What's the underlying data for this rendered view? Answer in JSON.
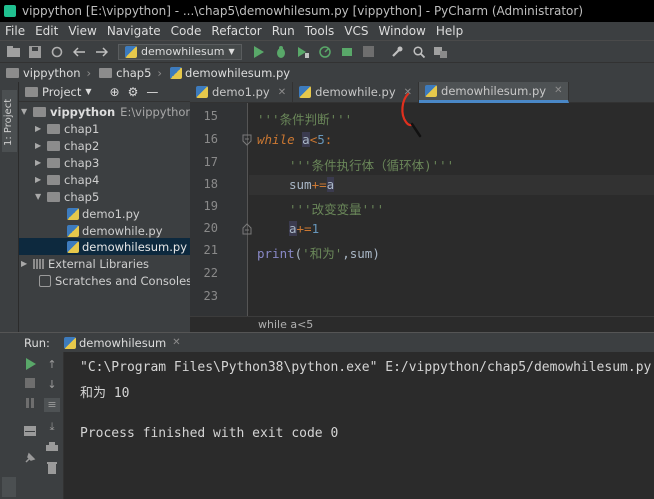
{
  "window": {
    "title": "vippython [E:\\vippython] - ...\\chap5\\demowhilesum.py [vippython] - PyCharm (Administrator)",
    "minimize": "—",
    "maximize": "☐",
    "close": "✕"
  },
  "menu": [
    "File",
    "Edit",
    "View",
    "Navigate",
    "Code",
    "Refactor",
    "Run",
    "Tools",
    "VCS",
    "Window",
    "Help"
  ],
  "toolbar": {
    "run_config": "demowhilesum"
  },
  "breadcrumb": {
    "project": "vippython",
    "folder": "chap5",
    "file": "demowhilesum.py"
  },
  "left_strip": {
    "project_tab": "1: Project"
  },
  "project_panel": {
    "title": "Project",
    "tree": [
      {
        "label": "vippython",
        "suffix": "E:\\vippython"
      },
      {
        "label": "chap1"
      },
      {
        "label": "chap2"
      },
      {
        "label": "chap3"
      },
      {
        "label": "chap4"
      },
      {
        "label": "chap5"
      },
      {
        "label": "demo1.py"
      },
      {
        "label": "demowhile.py"
      },
      {
        "label": "demowhilesum.py"
      },
      {
        "label": "External Libraries"
      },
      {
        "label": "Scratches and Consoles"
      }
    ]
  },
  "tabs": [
    {
      "label": "demo1.py"
    },
    {
      "label": "demowhile.py"
    },
    {
      "label": "demowhilesum.py",
      "active": true
    }
  ],
  "editor": {
    "line_numbers": [
      "15",
      "16",
      "17",
      "18",
      "19",
      "20",
      "21",
      "22",
      "23"
    ],
    "lines": {
      "l15_str": "'''条件判断'''",
      "l16_kw": "while",
      "l16_var": "a",
      "l16_op": "<",
      "l16_num": "5",
      "l16_colon": ":",
      "l17_str": "'''条件执行体（循环体)'''",
      "l18_var": "sum",
      "l18_op": "+=",
      "l18_rhs": "a",
      "l19_str": "'''改变变量'''",
      "l20_var": "a",
      "l20_op": "+=",
      "l20_num": "1",
      "l21_fn": "print",
      "l21_open": "(",
      "l21_str": "'和为'",
      "l21_rest": ",sum)"
    },
    "footer_crumb": "while a<5"
  },
  "run_panel": {
    "label": "Run:",
    "tab": "demowhilesum",
    "output": [
      "\"C:\\Program Files\\Python38\\python.exe\" E:/vippython/chap5/demowhilesum.py",
      "和为 10",
      "",
      "Process finished with exit code 0"
    ]
  },
  "colors": {
    "accent": "#4a88c7",
    "run_green": "#59a869",
    "annotation_red": "#e0301e"
  },
  "icons": [
    "folder-icon",
    "python-file-icon",
    "run-icon",
    "debug-icon",
    "stop-icon",
    "search-icon",
    "wrench-icon",
    "settings-icon",
    "sync-icon",
    "back-arrow-icon",
    "forward-arrow-icon"
  ]
}
